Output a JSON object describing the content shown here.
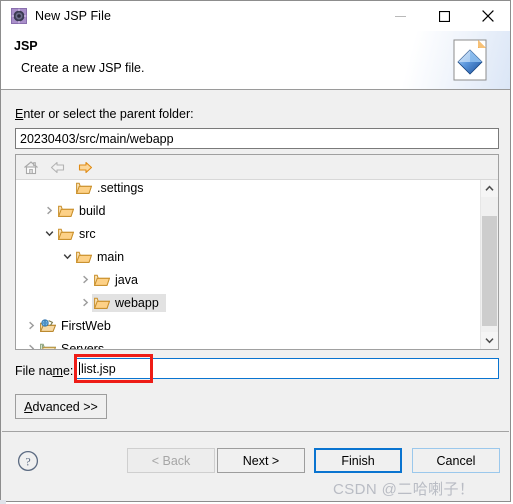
{
  "window": {
    "title": "New JSP File",
    "icon": "jsp-wizard-icon",
    "controls": [
      {
        "name": "minimize-button",
        "glyph": "minimize-icon",
        "enabled": false
      },
      {
        "name": "maximize-button",
        "glyph": "maximize-icon",
        "enabled": true
      },
      {
        "name": "close-button",
        "glyph": "close-icon",
        "enabled": true
      }
    ]
  },
  "banner": {
    "title": "JSP",
    "subtitle": "Create a new JSP file.",
    "icon": "jsp-file-banner-icon"
  },
  "form": {
    "parent_folder_label": "Enter or select the parent folder:",
    "parent_folder_label_mnemonic": "E",
    "parent_folder_value": "20230403/src/main/webapp",
    "file_name_label": "File name:",
    "file_name_label_mnemonic": "m",
    "file_name_value": "list.jsp",
    "advanced_label": "Advanced >>",
    "advanced_mnemonic": "A"
  },
  "tree_toolbar": [
    {
      "name": "home-icon",
      "label": "Home",
      "enabled": false
    },
    {
      "name": "back-arrow-icon",
      "label": "Back",
      "enabled": false
    },
    {
      "name": "forward-arrow-icon",
      "label": "Forward",
      "enabled": true
    }
  ],
  "tree": {
    "items": [
      {
        "label": ".settings",
        "indent": 2,
        "twisty": "none",
        "icon": "folder-icon",
        "selected": false
      },
      {
        "label": "build",
        "indent": 1,
        "twisty": "collapsed",
        "icon": "folder-icon",
        "selected": false
      },
      {
        "label": "src",
        "indent": 1,
        "twisty": "expanded",
        "icon": "folder-icon",
        "selected": false
      },
      {
        "label": "main",
        "indent": 2,
        "twisty": "expanded",
        "icon": "folder-icon",
        "selected": false
      },
      {
        "label": "java",
        "indent": 3,
        "twisty": "collapsed",
        "icon": "folder-icon",
        "selected": false
      },
      {
        "label": "webapp",
        "indent": 3,
        "twisty": "collapsed",
        "icon": "folder-icon",
        "selected": true
      },
      {
        "label": "FirstWeb",
        "indent": 0,
        "twisty": "collapsed",
        "icon": "web-project-icon",
        "selected": false
      },
      {
        "label": "Servers",
        "indent": 0,
        "twisty": "collapsed",
        "icon": "server-folder-icon",
        "selected": false
      }
    ],
    "scrollbar": {
      "up": "scroll-up-icon",
      "down": "scroll-down-icon"
    }
  },
  "footer": {
    "help": "help-icon",
    "buttons": [
      {
        "name": "back-button",
        "label": "< Back",
        "mnemonic": "B",
        "state": "disabled"
      },
      {
        "name": "next-button",
        "label": "Next >",
        "mnemonic": "N",
        "state": "normal"
      },
      {
        "name": "finish-button",
        "label": "Finish",
        "mnemonic": "",
        "state": "default"
      },
      {
        "name": "cancel-button",
        "label": "Cancel",
        "mnemonic": "",
        "state": "softblue"
      }
    ]
  },
  "watermark": {
    "text": "CSDN @二哈喇子！"
  },
  "colors": {
    "accent": "#0a74d0",
    "annotation": "#ee1c16",
    "dialog_bg": "#f0f0f0",
    "folder": "#f0b354",
    "selection": "#e2e2e2"
  }
}
